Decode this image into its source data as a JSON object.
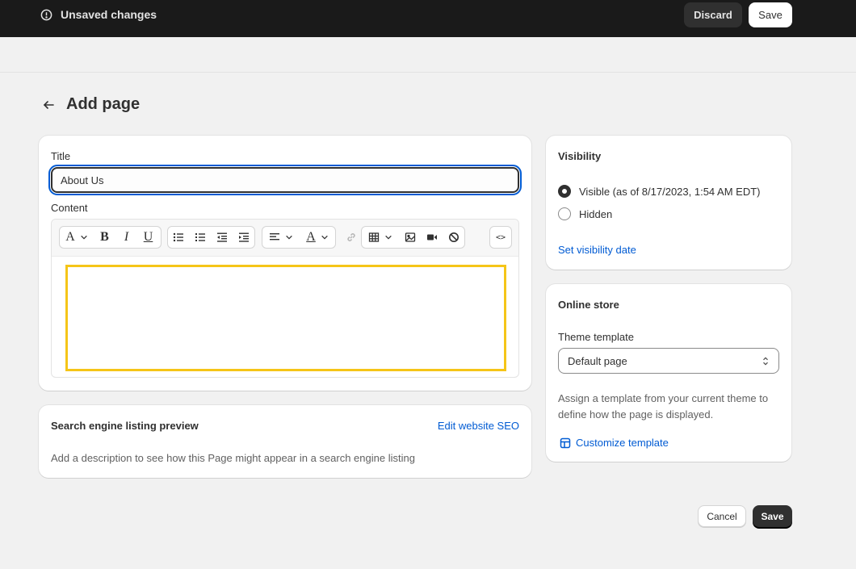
{
  "topbar": {
    "status": "Unsaved changes",
    "discard_label": "Discard",
    "save_label": "Save"
  },
  "page": {
    "title": "Add page"
  },
  "main_card": {
    "title_label": "Title",
    "title_value": "About Us",
    "content_label": "Content"
  },
  "toolbar": {
    "icons": [
      "font-style",
      "bold",
      "italic",
      "underline",
      "bulleted-list",
      "numbered-list",
      "outdent",
      "indent",
      "align",
      "text-color",
      "link",
      "table",
      "image",
      "video",
      "clear-formatting",
      "code"
    ],
    "bold_glyph": "B",
    "italic_glyph": "I",
    "underline_glyph": "U",
    "font_glyph": "A",
    "color_glyph": "A",
    "code_glyph": "<>"
  },
  "seo": {
    "title": "Search engine listing preview",
    "edit_link": "Edit website SEO",
    "description": "Add a description to see how this Page might appear in a search engine listing"
  },
  "visibility": {
    "title": "Visibility",
    "options": [
      {
        "label": "Visible (as of 8/17/2023, 1:54 AM EDT)",
        "selected": true
      },
      {
        "label": "Hidden",
        "selected": false
      }
    ],
    "set_date_link": "Set visibility date"
  },
  "online_store": {
    "title": "Online store",
    "template_label": "Theme template",
    "template_value": "Default page",
    "help_text": "Assign a template from your current theme to define how the page is displayed.",
    "customize_link": "Customize template"
  },
  "footer": {
    "cancel_label": "Cancel",
    "save_label": "Save"
  },
  "colors": {
    "accent": "#005bd3",
    "topbar": "#1a1a1a",
    "highlight": "#f5c518"
  }
}
